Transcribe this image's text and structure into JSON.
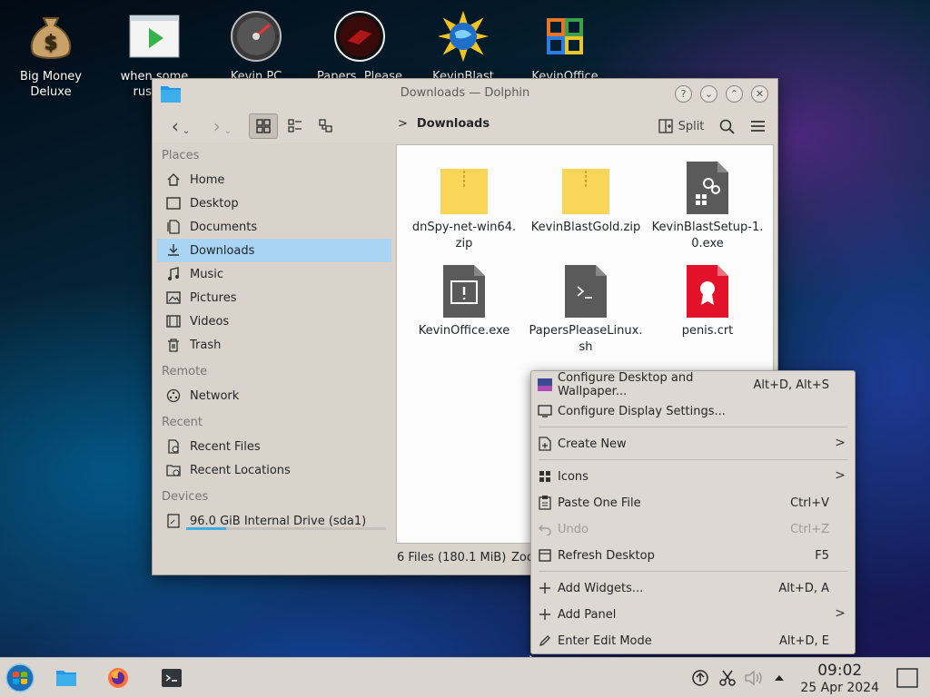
{
  "desktop": {
    "icons": [
      {
        "label": "Big Money\nDeluxe"
      },
      {
        "label": "when some\nrussian"
      },
      {
        "label": "Kevin PC"
      },
      {
        "label": "Papers, Please"
      },
      {
        "label": "KevinBlast"
      },
      {
        "label": "KevinOffice"
      }
    ]
  },
  "window": {
    "title": "Downloads — Dolphin",
    "toolbar": {
      "breadcrumb_sep": ">",
      "breadcrumb": "Downloads",
      "split_label": "Split"
    },
    "sidebar": {
      "sections": {
        "places": "Places",
        "remote": "Remote",
        "recent": "Recent",
        "devices": "Devices"
      },
      "places": [
        "Home",
        "Desktop",
        "Documents",
        "Downloads",
        "Music",
        "Pictures",
        "Videos",
        "Trash"
      ],
      "remote": [
        "Network"
      ],
      "recent": [
        "Recent Files",
        "Recent Locations"
      ],
      "devices": [
        "96.0 GiB Internal Drive (sda1)"
      ],
      "drive_usage": 0.2
    },
    "files": [
      {
        "name": "dnSpy-net-win64.\nzip"
      },
      {
        "name": "KevinBlastGold.zip"
      },
      {
        "name": "KevinBlastSetup-1.\n0.exe"
      },
      {
        "name": "KevinOffice.exe"
      },
      {
        "name": "PapersPleaseLinux.\nsh"
      },
      {
        "name": "penis.crt"
      }
    ],
    "status": "6 Files (180.1 MiB)",
    "zoom_label": "Zoo"
  },
  "context_menu": {
    "items": [
      {
        "label": "Configure Desktop and Wallpaper...",
        "shortcut": "Alt+D, Alt+S"
      },
      {
        "label": "Configure Display Settings...",
        "shortcut": ""
      },
      {
        "label": "Create New",
        "shortcut": "",
        "submenu": ">"
      },
      {
        "label": "Icons",
        "shortcut": "",
        "submenu": ">"
      },
      {
        "label": "Paste One File",
        "shortcut": "Ctrl+V"
      },
      {
        "label": "Undo",
        "shortcut": "Ctrl+Z"
      },
      {
        "label": "Refresh Desktop",
        "shortcut": "F5"
      },
      {
        "label": "Add Widgets...",
        "shortcut": "Alt+D, A"
      },
      {
        "label": "Add Panel",
        "shortcut": "",
        "submenu": ">"
      },
      {
        "label": "Enter Edit Mode",
        "shortcut": "Alt+D, E"
      }
    ]
  },
  "taskbar": {
    "time": "09:02",
    "date": "25 Apr 2024"
  },
  "colors": {
    "accent": "#3daee9",
    "selection": "#a9d4f3",
    "zip_folder": "#f9d558",
    "exe_gray": "#5a5a5a",
    "crt_red": "#e3112a"
  }
}
